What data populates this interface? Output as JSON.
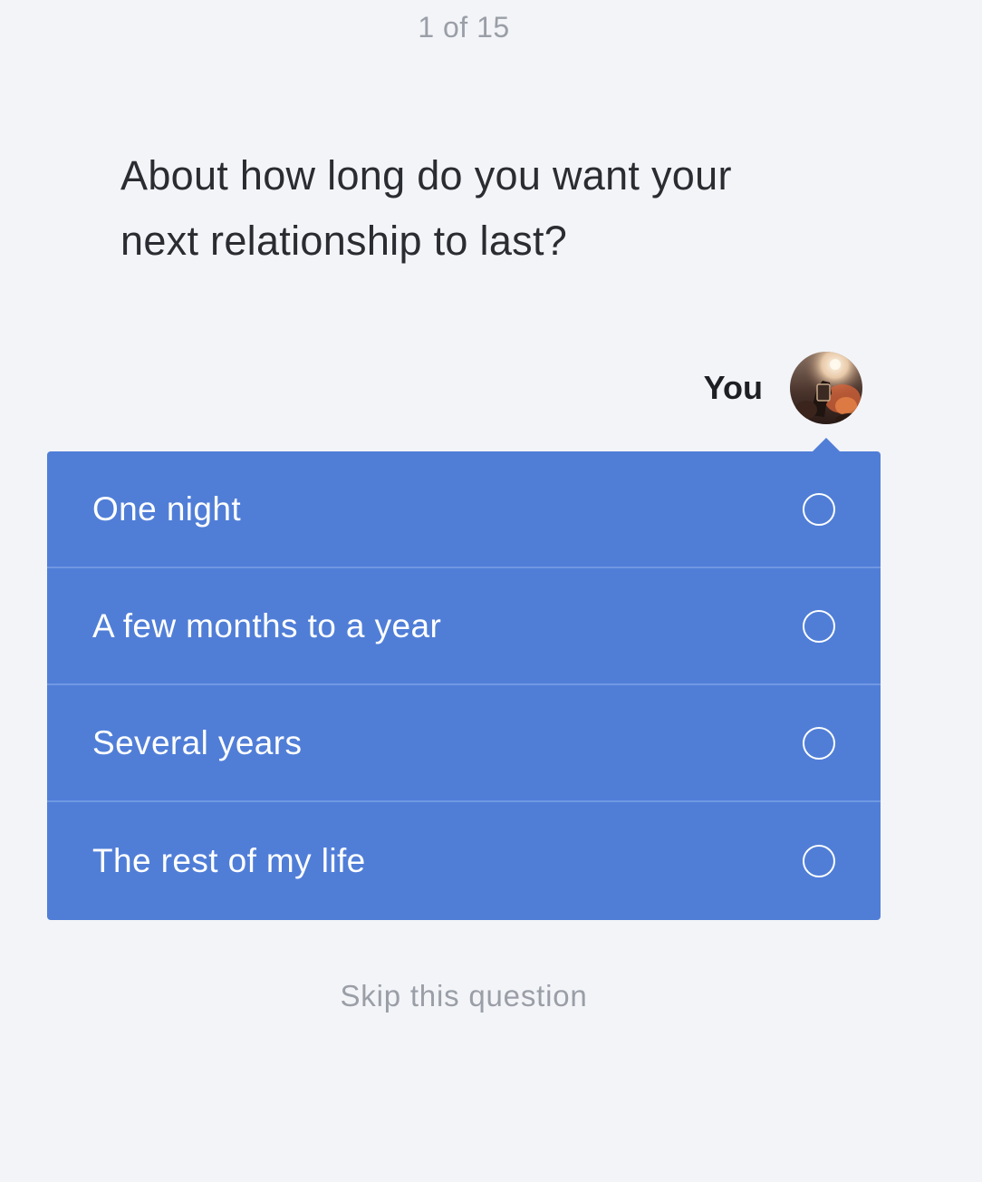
{
  "progress": {
    "text": "1 of 15"
  },
  "question": {
    "text": "About how long do you want your next relationship to last?"
  },
  "answerer": {
    "label": "You"
  },
  "options": [
    {
      "label": "One night",
      "selected": false
    },
    {
      "label": "A few months to a year",
      "selected": false
    },
    {
      "label": "Several years",
      "selected": false
    },
    {
      "label": "The rest of my life",
      "selected": false
    }
  ],
  "skip": {
    "label": "Skip this question"
  },
  "colors": {
    "background": "#f3f4f8",
    "accent": "#507ed7",
    "muted_text": "#9a9ea6"
  }
}
